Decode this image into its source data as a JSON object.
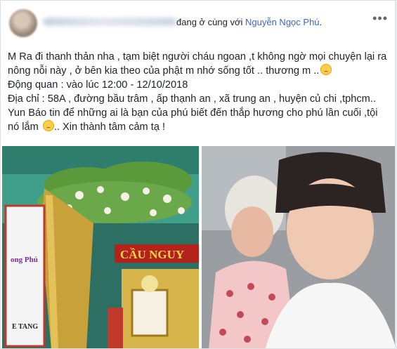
{
  "header": {
    "status_text": "đang ở cùng với",
    "tagged_name": "Nguyễn Ngọc Phú",
    "period": ".",
    "more_label": "•••"
  },
  "post": {
    "line1": "M Ra đi thanh thản nha , tạm biệt người cháu ngoan ,t không ngờ mọi chuyện lại ra",
    "line2": "nông nỗi này , ở bên kia theo của phật m nhớ sống tốt .. thương m ..",
    "line3": "Động quan : vào lúc 12:00 - 12/10/2018",
    "line4": "Địa chỉ : 58A , đường bầu trâm , ấp thạnh an , xã trung an , huyện củ chi ,tphcm..",
    "line5": "Yun Báo tin để những ai là bạn của phú biết đến thắp hương cho phú lần cuối ,tội",
    "line6": "nó lắm",
    "line6_tail": ".. Xin thành tâm cảm tạ !"
  },
  "photo_left": {
    "sign_text": "CẦU NGUY",
    "portrait_name": "ong Phú",
    "portrait_subtitle": "E TANG"
  },
  "colors": {
    "link": "#4267b2",
    "text": "#1d2129",
    "border": "#dddfe2"
  },
  "icons": [
    "more-options-icon",
    "sad-emoji-icon"
  ]
}
